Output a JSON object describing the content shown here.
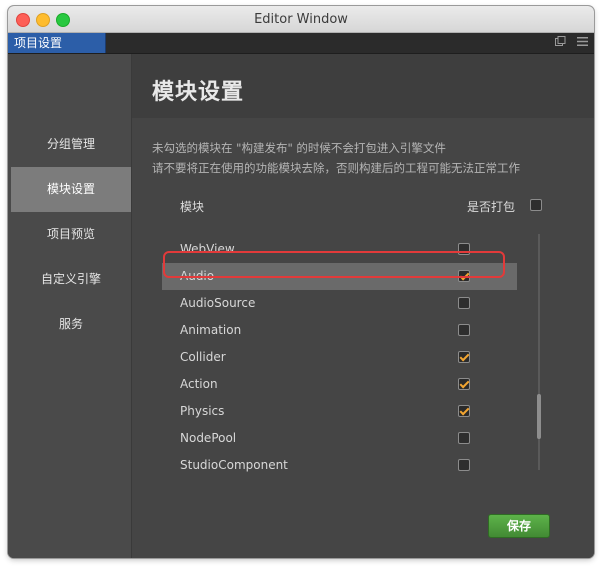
{
  "window": {
    "title": "Editor Window"
  },
  "tab": {
    "label": "项目设置"
  },
  "sidebar": {
    "items": [
      {
        "label": "分组管理"
      },
      {
        "label": "模块设置"
      },
      {
        "label": "项目预览"
      },
      {
        "label": "自定义引擎"
      },
      {
        "label": "服务"
      }
    ],
    "active_index": 1
  },
  "main": {
    "title": "模块设置",
    "desc1": "未勾选的模块在 \"构建发布\" 的时候不会打包进入引擎文件",
    "desc2": "请不要将正在使用的功能模块去除，否则构建后的工程可能无法正常工作",
    "col_module": "模块",
    "col_pack": "是否打包",
    "header_checked": false,
    "modules": [
      {
        "name": "WebView",
        "checked": false
      },
      {
        "name": "Audio",
        "checked": true
      },
      {
        "name": "AudioSource",
        "checked": false
      },
      {
        "name": "Animation",
        "checked": false
      },
      {
        "name": "Collider",
        "checked": true
      },
      {
        "name": "Action",
        "checked": true
      },
      {
        "name": "Physics",
        "checked": true
      },
      {
        "name": "NodePool",
        "checked": false
      },
      {
        "name": "StudioComponent",
        "checked": false
      }
    ],
    "selected_index": 1,
    "save_label": "保存"
  },
  "colors": {
    "accent_check": "#f2a531",
    "tab_blue": "#2c5ea8",
    "save_green": "#4f9e3f",
    "highlight_red": "#e23a3a"
  }
}
